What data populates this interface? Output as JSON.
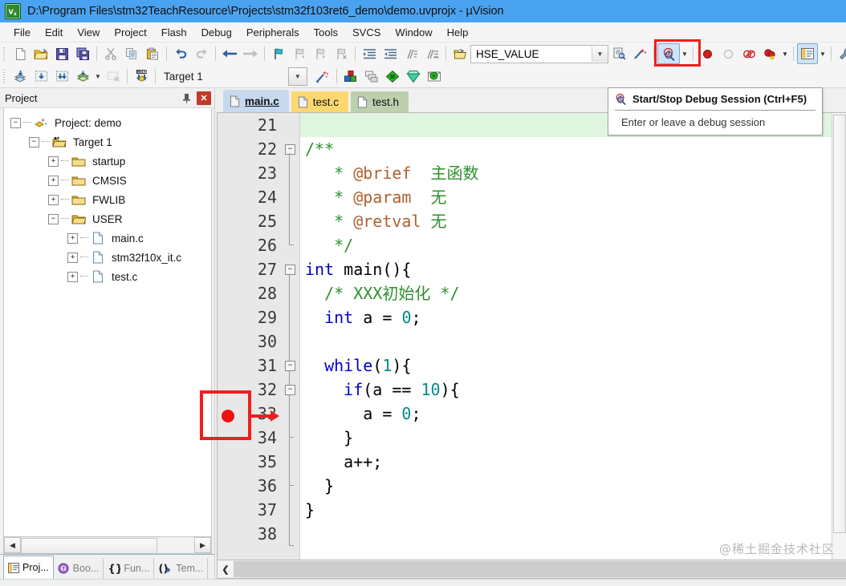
{
  "window": {
    "title": "D:\\Program Files\\stm32TeachResource\\Projects\\stm32f103ret6_demo\\demo.uvprojx - µVision",
    "app_icon": "uvision-logo-icon"
  },
  "menubar": {
    "items": [
      "File",
      "Edit",
      "View",
      "Project",
      "Flash",
      "Debug",
      "Peripherals",
      "Tools",
      "SVCS",
      "Window",
      "Help"
    ]
  },
  "toolbar_main": {
    "buttons": [
      {
        "name": "new-file-button",
        "icon": "new-file-icon"
      },
      {
        "name": "open-file-button",
        "icon": "open-folder-icon"
      },
      {
        "name": "save-button",
        "icon": "floppy-save-icon"
      },
      {
        "name": "save-all-button",
        "icon": "floppy-save-all-icon"
      },
      {
        "name": "cut-button",
        "icon": "scissors-icon"
      },
      {
        "name": "copy-button",
        "icon": "copy-icon"
      },
      {
        "name": "paste-button",
        "icon": "clipboard-paste-icon"
      },
      {
        "name": "undo-button",
        "icon": "undo-arrow-icon"
      },
      {
        "name": "redo-button",
        "icon": "redo-arrow-icon"
      },
      {
        "name": "navigate-back-button",
        "icon": "arrow-left-icon"
      },
      {
        "name": "navigate-forward-button",
        "icon": "arrow-right-icon"
      },
      {
        "name": "bookmark-toggle-button",
        "icon": "blue-flag-icon"
      },
      {
        "name": "bookmark-prev-button",
        "icon": "flag-prev-icon"
      },
      {
        "name": "bookmark-next-button",
        "icon": "flag-next-icon"
      },
      {
        "name": "bookmark-clear-button",
        "icon": "flag-clear-icon"
      },
      {
        "name": "indent-button",
        "icon": "indent-right-icon"
      },
      {
        "name": "outdent-button",
        "icon": "indent-left-icon"
      },
      {
        "name": "comment-button",
        "icon": "comment-lines-icon"
      },
      {
        "name": "uncomment-button",
        "icon": "uncomment-lines-icon"
      }
    ],
    "find_combo": {
      "value": "HSE_VALUE",
      "icon": "binoculars-find-icon"
    },
    "after_find_buttons": [
      {
        "name": "find-in-files-button",
        "icon": "find-in-files-icon"
      },
      {
        "name": "configure-button",
        "icon": "magic-wand-tool-icon"
      }
    ],
    "debug_button": {
      "name": "start-stop-debug-session-button",
      "icon": "debug-magnifier-icon",
      "highlighted": true
    },
    "debug_controls": [
      {
        "name": "insert-remove-breakpoint-button",
        "icon": "red-breakpoint-dot-icon"
      },
      {
        "name": "enable-disable-breakpoint-button",
        "icon": "hollow-breakpoint-dot-icon"
      },
      {
        "name": "disable-all-breakpoints-button",
        "icon": "breakpoints-outline-icon"
      },
      {
        "name": "kill-all-breakpoints-button",
        "icon": "breakpoint-kill-icon"
      }
    ],
    "window_layout_button": {
      "name": "manage-windows-button",
      "icon": "window-layout-icon"
    },
    "settings_button": {
      "name": "configuration-wizard-button",
      "icon": "wrench-icon"
    }
  },
  "toolbar_build": {
    "buttons": [
      {
        "name": "translate-file-button",
        "icon": "translate-layers-icon"
      },
      {
        "name": "build-target-button",
        "icon": "build-icon"
      },
      {
        "name": "rebuild-all-button",
        "icon": "rebuild-all-icon"
      },
      {
        "name": "batch-build-button",
        "icon": "batch-build-icon"
      },
      {
        "name": "stop-build-button",
        "icon": "stop-build-icon"
      },
      {
        "name": "download-to-flash-button",
        "icon": "load-download-icon"
      }
    ],
    "target_combo": {
      "value": "Target 1"
    },
    "after_target_buttons": [
      {
        "name": "target-options-button",
        "icon": "magic-wand-target-icon"
      },
      {
        "name": "manage-project-items-button",
        "icon": "project-items-icon"
      },
      {
        "name": "manage-multi-project-button",
        "icon": "multi-project-icon"
      },
      {
        "name": "pack-installer-button",
        "icon": "green-diamond-icon"
      },
      {
        "name": "manage-run-time-env-button",
        "icon": "green-gem-icon"
      },
      {
        "name": "select-software-packs-button",
        "icon": "software-packs-icon"
      }
    ]
  },
  "tooltip": {
    "visible": true,
    "icon": "debug-magnifier-icon",
    "title": "Start/Stop Debug Session (Ctrl+F5)",
    "description": "Enter or leave a debug session"
  },
  "project_panel": {
    "title": "Project",
    "pin_icon": "pin-icon",
    "close_icon": "close-x-icon",
    "tree": [
      {
        "label": "Project: demo",
        "icon": "project-icon",
        "depth": 0,
        "expander": "-"
      },
      {
        "label": "Target 1",
        "icon": "target-folder-icon",
        "depth": 1,
        "expander": "-"
      },
      {
        "label": "startup",
        "icon": "folder-icon",
        "depth": 2,
        "expander": "+"
      },
      {
        "label": "CMSIS",
        "icon": "folder-icon",
        "depth": 2,
        "expander": "+"
      },
      {
        "label": "FWLIB",
        "icon": "folder-icon",
        "depth": 2,
        "expander": "+"
      },
      {
        "label": "USER",
        "icon": "folder-open-icon",
        "depth": 2,
        "expander": "-"
      },
      {
        "label": "main.c",
        "icon": "c-file-icon",
        "depth": 3,
        "expander": "+"
      },
      {
        "label": "stm32f10x_it.c",
        "icon": "c-file-icon",
        "depth": 3,
        "expander": "+"
      },
      {
        "label": "test.c",
        "icon": "c-file-icon",
        "depth": 3,
        "expander": "+"
      }
    ],
    "bottom_tabs": [
      {
        "label": "Proj...",
        "icon": "project-tab-icon",
        "active": true
      },
      {
        "label": "Boo...",
        "icon": "books-tab-icon",
        "active": false
      },
      {
        "label": "Fun...",
        "icon": "functions-braces-icon",
        "active": false
      },
      {
        "label": "Tem...",
        "icon": "templates-icon",
        "active": false
      }
    ]
  },
  "editor": {
    "tabs": [
      {
        "label": "main.c",
        "icon": "c-file-icon",
        "active": true,
        "color": "#c6d9ef"
      },
      {
        "label": "test.c",
        "icon": "c-file-icon",
        "active": false,
        "color": "#fdd870"
      },
      {
        "label": "test.h",
        "icon": "h-file-icon",
        "active": false,
        "color": "#bccfae"
      }
    ],
    "first_line_number": 21,
    "lines": [
      {
        "n": 21,
        "highlight": true,
        "fold": null,
        "tokens": []
      },
      {
        "n": 22,
        "highlight": false,
        "fold": "start",
        "tokens": [
          {
            "t": "/**",
            "c": "k-comment"
          }
        ]
      },
      {
        "n": 23,
        "highlight": false,
        "fold": "mid",
        "tokens": [
          {
            "t": "   * ",
            "c": "k-comment"
          },
          {
            "t": "@brief",
            "c": "k-doctag"
          },
          {
            "t": "  主函数",
            "c": "k-cn"
          }
        ]
      },
      {
        "n": 24,
        "highlight": false,
        "fold": "mid",
        "tokens": [
          {
            "t": "   * ",
            "c": "k-comment"
          },
          {
            "t": "@param",
            "c": "k-doctag"
          },
          {
            "t": "  无",
            "c": "k-cn"
          }
        ]
      },
      {
        "n": 25,
        "highlight": false,
        "fold": "mid",
        "tokens": [
          {
            "t": "   * ",
            "c": "k-comment"
          },
          {
            "t": "@retval",
            "c": "k-doctag"
          },
          {
            "t": " 无",
            "c": "k-cn"
          }
        ]
      },
      {
        "n": 26,
        "highlight": false,
        "fold": "end",
        "tokens": [
          {
            "t": "   */",
            "c": "k-comment"
          }
        ]
      },
      {
        "n": 27,
        "highlight": false,
        "fold": "start",
        "tokens": [
          {
            "t": "int",
            "c": "k-key"
          },
          {
            "t": " main(){",
            "c": "k-plain"
          }
        ]
      },
      {
        "n": 28,
        "highlight": false,
        "fold": "mid",
        "tokens": [
          {
            "t": "  /* XXX初始化 */",
            "c": "k-comment"
          }
        ]
      },
      {
        "n": 29,
        "highlight": false,
        "fold": "mid",
        "tokens": [
          {
            "t": "  ",
            "c": "k-plain"
          },
          {
            "t": "int",
            "c": "k-key"
          },
          {
            "t": " a = ",
            "c": "k-plain"
          },
          {
            "t": "0",
            "c": "k-num"
          },
          {
            "t": ";",
            "c": "k-plain"
          }
        ]
      },
      {
        "n": 30,
        "highlight": false,
        "fold": "mid",
        "tokens": []
      },
      {
        "n": 31,
        "highlight": false,
        "fold": "start2",
        "tokens": [
          {
            "t": "  ",
            "c": "k-plain"
          },
          {
            "t": "while",
            "c": "k-key"
          },
          {
            "t": "(",
            "c": "k-plain"
          },
          {
            "t": "1",
            "c": "k-num"
          },
          {
            "t": "){",
            "c": "k-plain"
          }
        ]
      },
      {
        "n": 32,
        "highlight": false,
        "fold": "start3",
        "tokens": [
          {
            "t": "    ",
            "c": "k-plain"
          },
          {
            "t": "if",
            "c": "k-key"
          },
          {
            "t": "(a == ",
            "c": "k-plain"
          },
          {
            "t": "10",
            "c": "k-num"
          },
          {
            "t": "){",
            "c": "k-plain"
          }
        ]
      },
      {
        "n": 33,
        "highlight": false,
        "fold": "mid",
        "tokens": [
          {
            "t": "      a = ",
            "c": "k-plain"
          },
          {
            "t": "0",
            "c": "k-num"
          },
          {
            "t": ";",
            "c": "k-plain"
          }
        ]
      },
      {
        "n": 34,
        "highlight": false,
        "fold": "tick",
        "tokens": [
          {
            "t": "    }",
            "c": "k-plain"
          }
        ]
      },
      {
        "n": 35,
        "highlight": false,
        "fold": "mid",
        "tokens": [
          {
            "t": "    a++;",
            "c": "k-plain"
          }
        ]
      },
      {
        "n": 36,
        "highlight": false,
        "fold": "tick",
        "tokens": [
          {
            "t": "  }",
            "c": "k-plain"
          }
        ]
      },
      {
        "n": 37,
        "highlight": false,
        "fold": "mid",
        "tokens": [
          {
            "t": "}",
            "c": "k-plain"
          }
        ]
      },
      {
        "n": 38,
        "highlight": false,
        "fold": "end",
        "tokens": []
      }
    ]
  },
  "annotation": {
    "box_color": "#f01e1e",
    "breakpoint_dot_color": "#ee1111",
    "arrow_target_line": 33,
    "name": "breakpoint-annotation"
  },
  "watermark": {
    "text": "@稀土掘金技术社区"
  }
}
